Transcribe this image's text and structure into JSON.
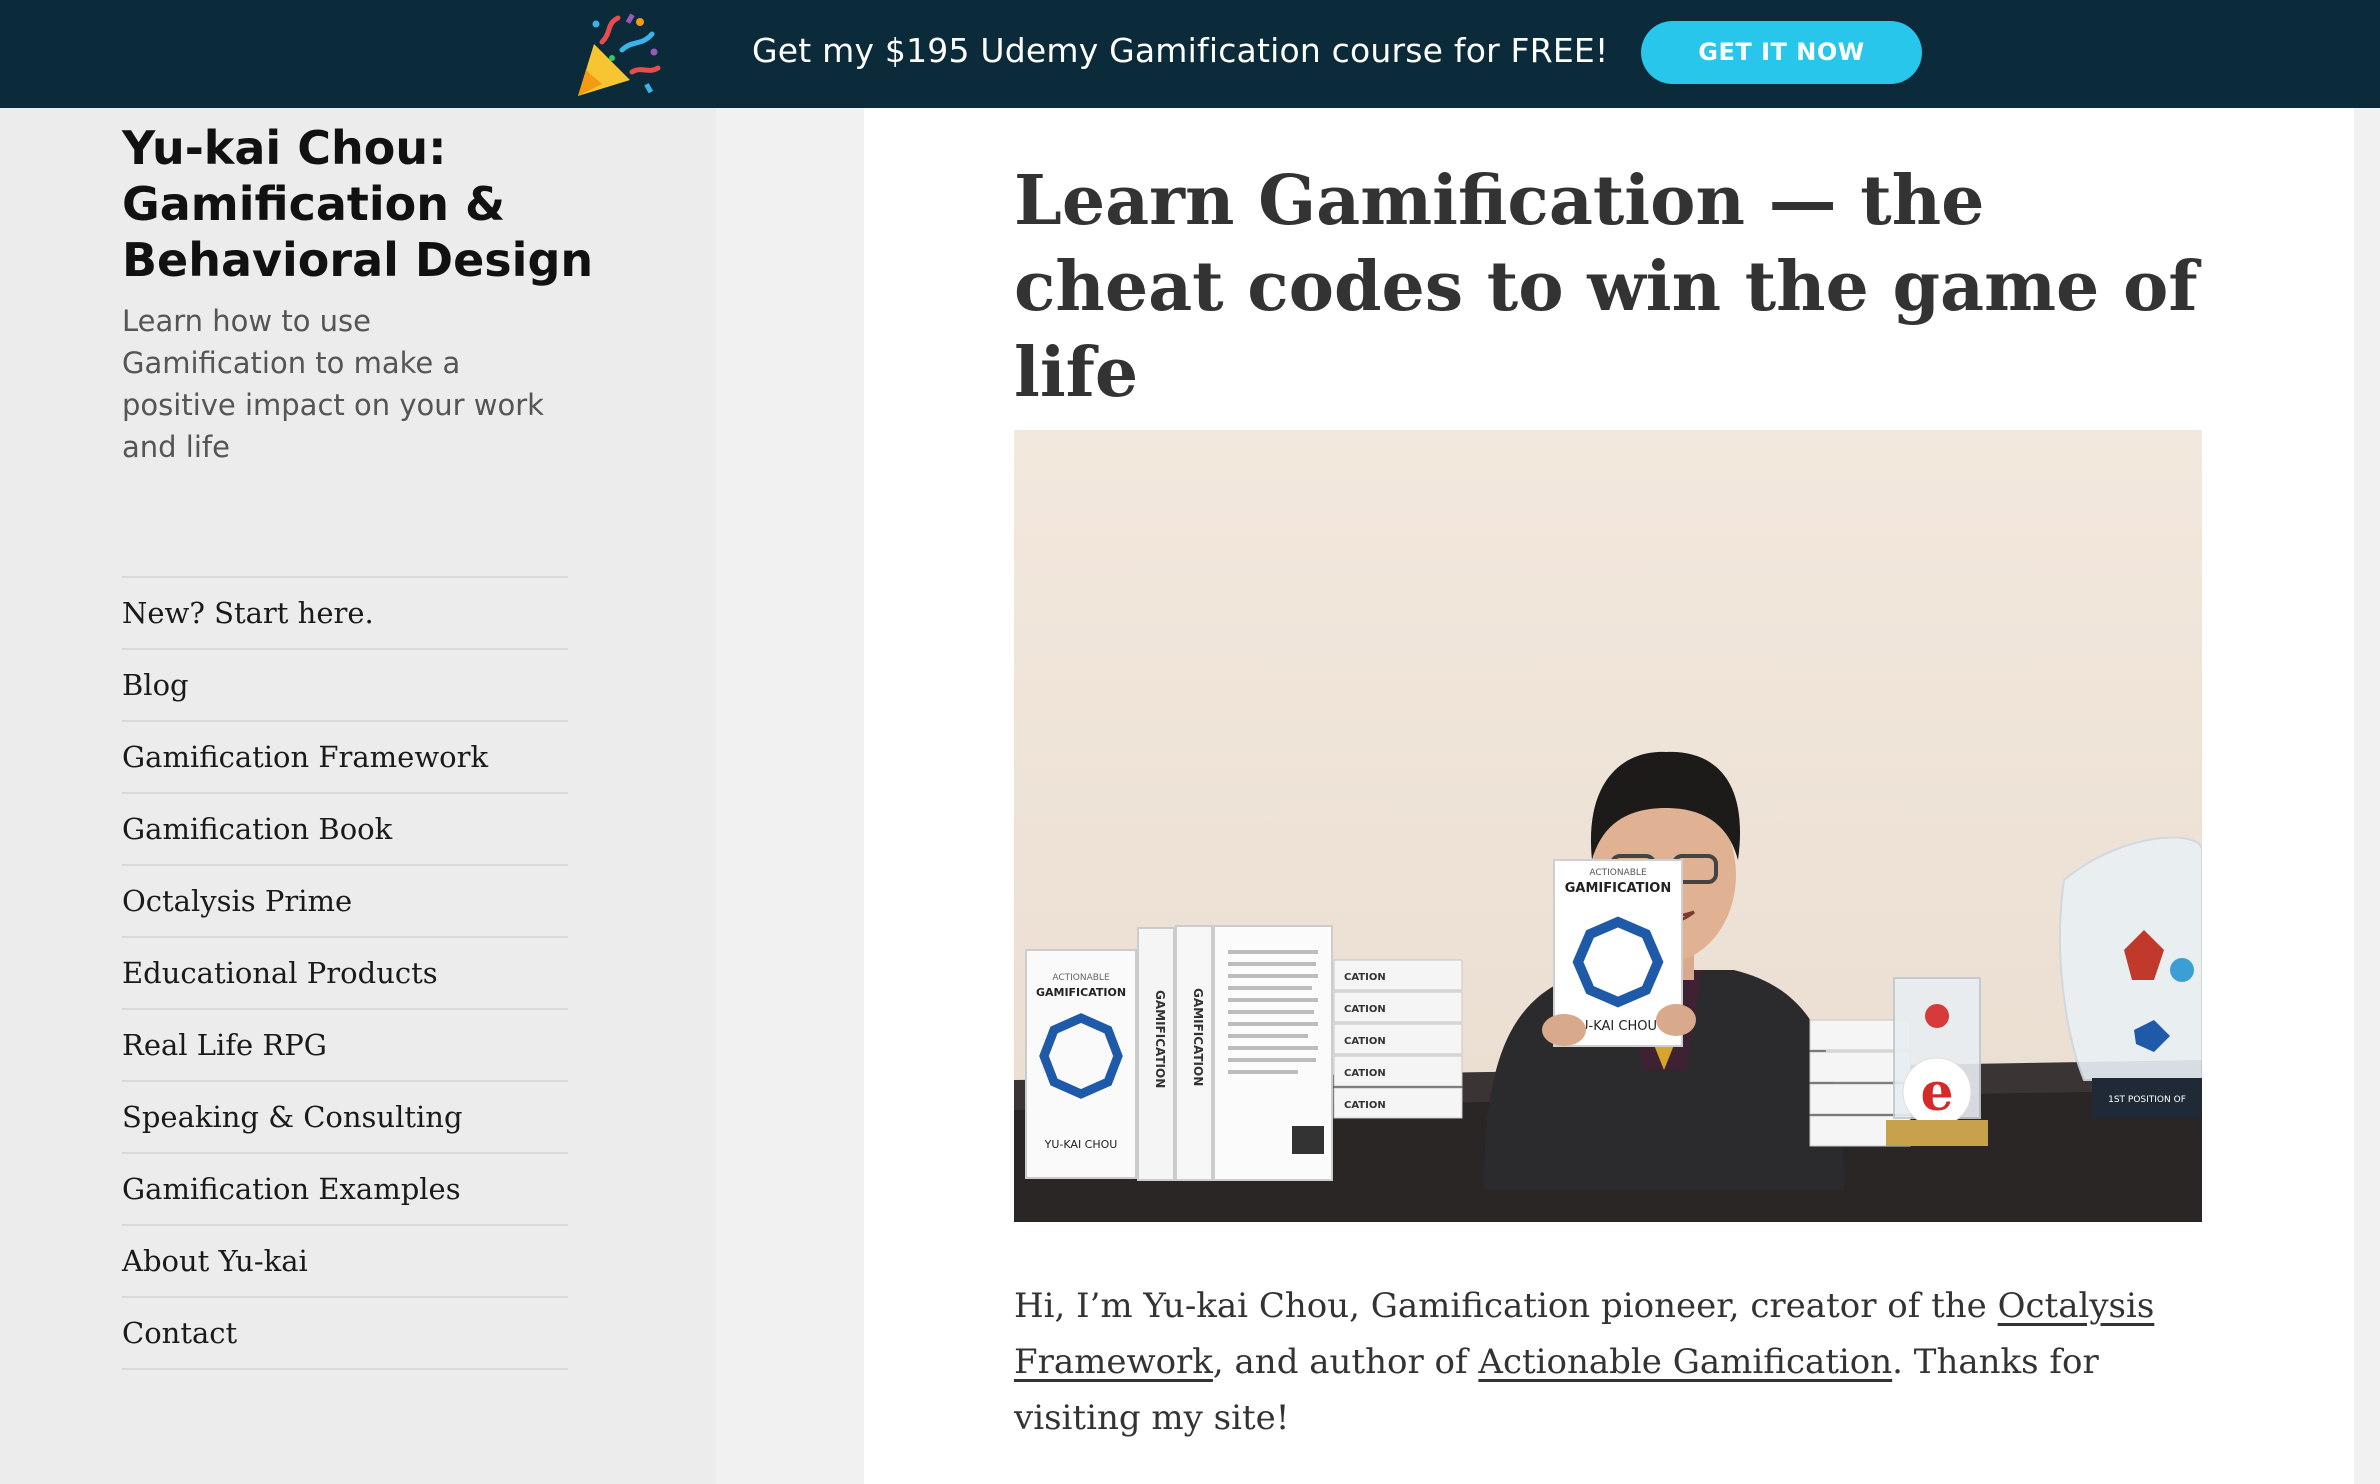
{
  "banner": {
    "icon": "party-popper-icon",
    "promo_text": "Get my $195 Udemy Gamification course for FREE!",
    "cta_label": "GET IT NOW",
    "background_color": "#0b2a3a",
    "cta_color": "#27c6ea"
  },
  "sidebar": {
    "site_title": "Yu-kai Chou: Gamification & Behavioral Design",
    "site_description": "Learn how to use Gamification to make a positive impact on your work and life",
    "nav_items": [
      {
        "label": "New? Start here."
      },
      {
        "label": "Blog"
      },
      {
        "label": "Gamification Framework"
      },
      {
        "label": "Gamification Book"
      },
      {
        "label": "Octalysis Prime"
      },
      {
        "label": "Educational Products"
      },
      {
        "label": "Real Life RPG"
      },
      {
        "label": "Speaking & Consulting"
      },
      {
        "label": "Gamification Examples"
      },
      {
        "label": "About Yu-kai"
      },
      {
        "label": "Contact"
      }
    ]
  },
  "article": {
    "title": "Learn Gamification — the cheat codes to win the game of life",
    "hero_book_spine_text": "GAMIFICATION",
    "hero_book_cover_top": "ACTIONABLE",
    "hero_book_author": "YU-KAI CHOU",
    "hero_cover_author_partial": "U-KAI CHOU",
    "hero_stack_text": "CATION",
    "hero_award_text": "1ST POSITION OF",
    "intro": {
      "text_1": "Hi, I’m Yu-kai Chou, Gamification pioneer, creator of the ",
      "link_1": "Octalysis Framework",
      "text_2": ", and author of ",
      "link_2": "Actionable Gamification",
      "text_3": ". Thanks for visiting my site!"
    }
  }
}
